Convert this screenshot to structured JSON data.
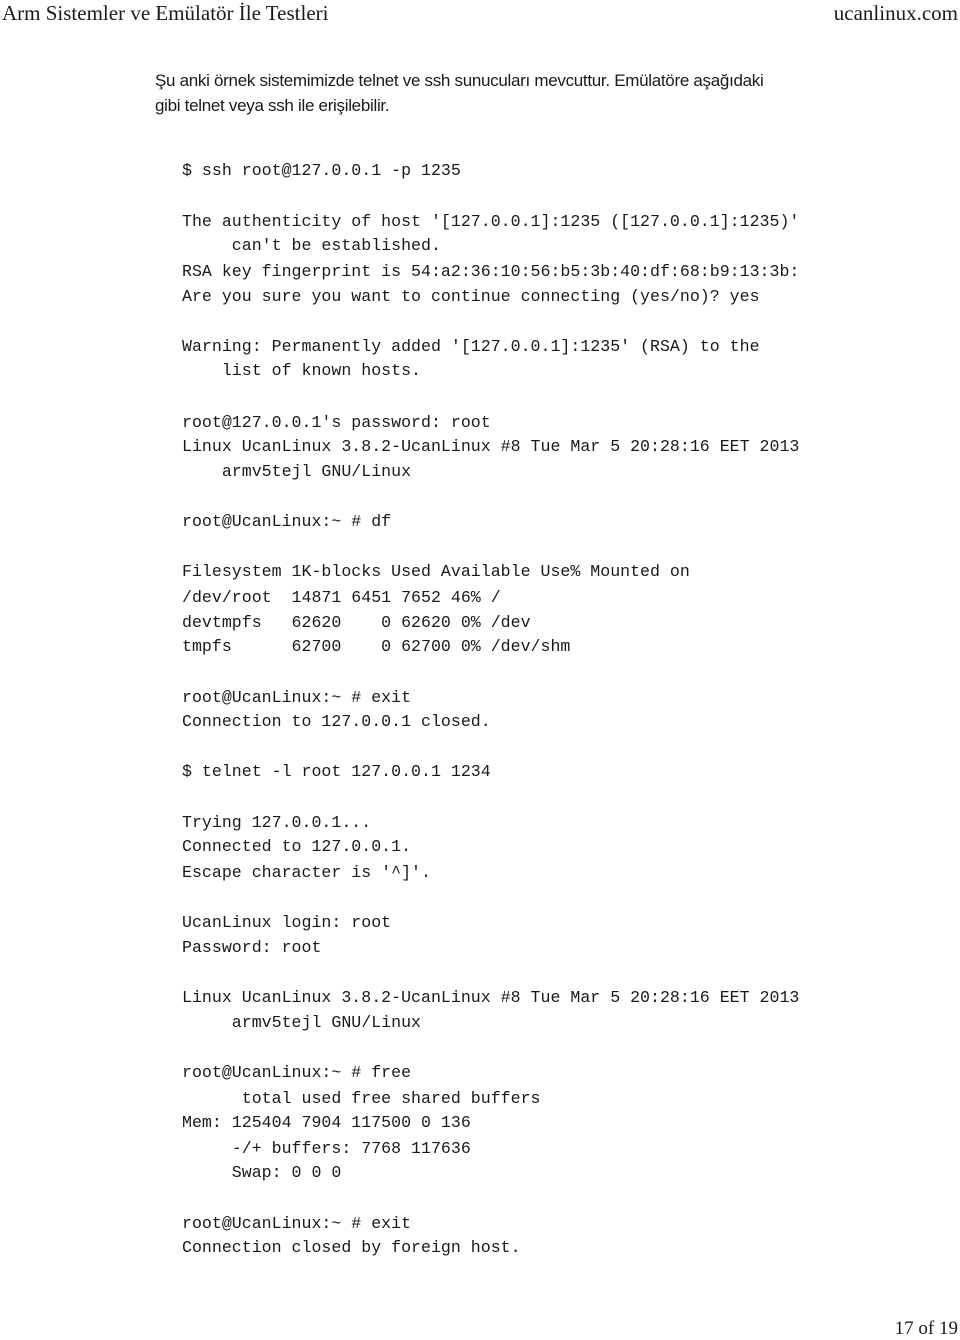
{
  "header": {
    "title": "Arm Sistemler ve Emülatör İle Testleri",
    "site": "ucanlinux.com"
  },
  "intro": {
    "lines": [
      "Şu anki örnek sistemimizde telnet ve ssh sunucuları mevcuttur. Emülatöre aşağıdaki",
      "gibi telnet veya ssh ile erişilebilir."
    ]
  },
  "terminal": {
    "lines": [
      "$ ssh root@127.0.0.1 -p 1235",
      "The authenticity of host '[127.0.0.1]:1235 ([127.0.0.1]:1235)'",
      "     can't be established.",
      "RSA key fingerprint is 54:a2:36:10:56:b5:3b:40:df:68:b9:13:3b:",
      "Are you sure you want to continue connecting (yes/no)? yes",
      "Warning: Permanently added '[127.0.0.1]:1235' (RSA) to the",
      "    list of known hosts.",
      "root@127.0.0.1's password: root",
      "Linux UcanLinux 3.8.2-UcanLinux #8 Tue Mar 5 20:28:16 EET 2013",
      "    armv5tejl GNU/Linux",
      "root@UcanLinux:~ # df",
      "Filesystem 1K-blocks Used Available Use% Mounted on",
      "/dev/root  14871 6451 7652 46% /",
      "devtmpfs   62620    0 62620 0% /dev",
      "tmpfs      62700    0 62700 0% /dev/shm",
      "root@UcanLinux:~ # exit",
      "Connection to 127.0.0.1 closed.",
      "$ telnet -l root 127.0.0.1 1234",
      "Trying 127.0.0.1...",
      "Connected to 127.0.0.1.",
      "Escape character is '^]'.",
      "UcanLinux login: root",
      "Password: root",
      "Linux UcanLinux 3.8.2-UcanLinux #8 Tue Mar 5 20:28:16 EET 2013",
      "     armv5tejl GNU/Linux",
      "root@UcanLinux:~ # free",
      "      total used free shared buffers",
      "Mem: 125404 7904 117500 0 136",
      "     -/+ buffers: 7768 117636",
      "     Swap: 0 0 0",
      "root@UcanLinux:~ # exit",
      "Connection closed by foreign host."
    ]
  },
  "footer": {
    "page_number": "17 of 19"
  }
}
